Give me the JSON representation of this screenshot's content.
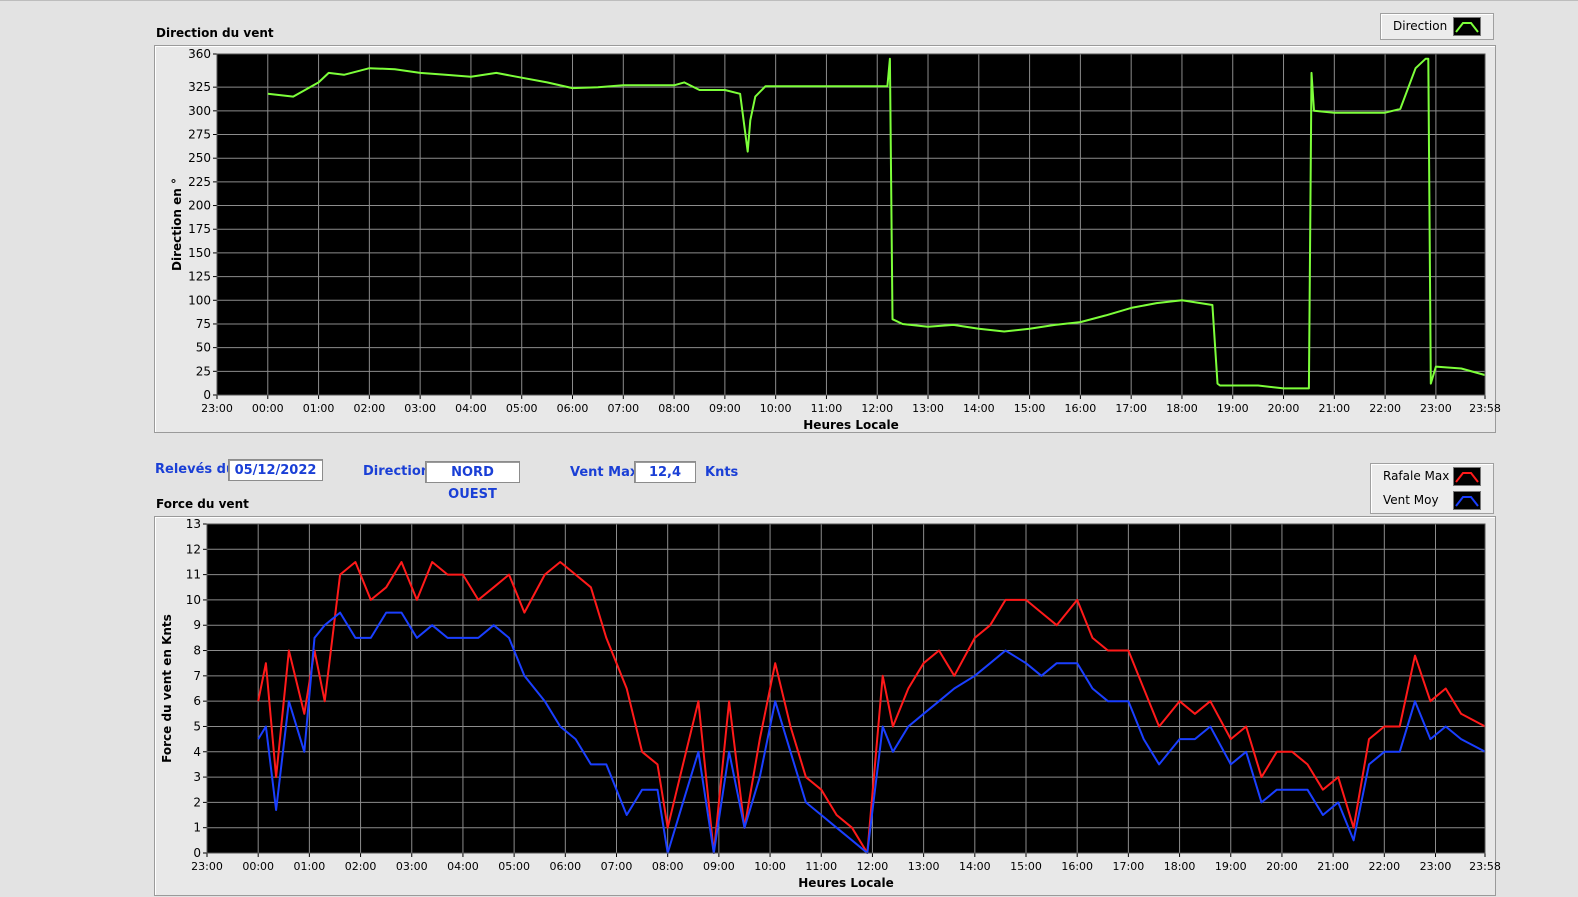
{
  "header": {
    "date_label": "Relevés du",
    "date_value": "05/12/2022",
    "direction_label": "Direction",
    "direction_value": "NORD OUEST",
    "vent_max_label": "Vent Max",
    "vent_max_value": "12,4",
    "vent_max_unit": "Knts"
  },
  "legends": {
    "direction": {
      "label": "Direction",
      "color": "#7dff3a"
    },
    "rafale": {
      "label": "Rafale Max",
      "color": "#ff1a1a"
    },
    "vent_moy": {
      "label": "Vent Moy",
      "color": "#1a3fff"
    }
  },
  "chart_data": [
    {
      "type": "line",
      "title": "Direction du vent",
      "xlabel": "Heures Locale",
      "ylabel": "Direction en °",
      "ylim": [
        0,
        360
      ],
      "yticks": [
        0,
        25,
        50,
        75,
        100,
        125,
        150,
        175,
        200,
        225,
        250,
        275,
        300,
        325,
        360
      ],
      "xticks": [
        "23:00",
        "00:00",
        "01:00",
        "02:00",
        "03:00",
        "04:00",
        "05:00",
        "06:00",
        "07:00",
        "08:00",
        "09:00",
        "10:00",
        "11:00",
        "12:00",
        "13:00",
        "14:00",
        "15:00",
        "16:00",
        "17:00",
        "18:00",
        "19:00",
        "20:00",
        "21:00",
        "22:00",
        "23:00",
        "23:58"
      ],
      "grid": true,
      "legend_position": "top-right",
      "series": [
        {
          "name": "Direction",
          "color": "#7dff3a",
          "x": [
            1.0,
            1.5,
            2.0,
            2.2,
            2.5,
            3.0,
            3.5,
            4.0,
            4.5,
            5.0,
            5.5,
            6.0,
            6.5,
            7.0,
            7.5,
            8.0,
            8.5,
            9.0,
            9.2,
            9.5,
            9.7,
            10.0,
            10.3,
            10.45,
            10.5,
            10.6,
            10.8,
            11.0,
            11.5,
            12.0,
            12.5,
            13.0,
            13.2,
            13.25,
            13.3,
            13.5,
            14.0,
            14.5,
            15.0,
            15.5,
            16.0,
            16.5,
            17.0,
            17.5,
            18.0,
            18.5,
            19.0,
            19.6,
            19.7,
            19.75,
            20.0,
            20.5,
            21.0,
            21.5,
            21.55,
            21.6,
            22.0,
            22.5,
            23.0,
            23.3,
            23.6,
            23.8,
            23.85,
            23.9,
            24.0,
            24.5,
            24.97
          ],
          "y": [
            318,
            315,
            330,
            340,
            338,
            345,
            344,
            340,
            338,
            336,
            340,
            335,
            330,
            324,
            325,
            327,
            327,
            327,
            330,
            322,
            322,
            322,
            318,
            257,
            290,
            315,
            326,
            326,
            326,
            326,
            326,
            326,
            326,
            355,
            80,
            75,
            72,
            74,
            70,
            67,
            70,
            74,
            77,
            84,
            92,
            97,
            100,
            95,
            12,
            10,
            10,
            10,
            7,
            7,
            340,
            300,
            298,
            298,
            298,
            302,
            345,
            355,
            355,
            12,
            30,
            28,
            21
          ]
        }
      ]
    },
    {
      "type": "line",
      "title": "Force du vent",
      "xlabel": "Heures Locale",
      "ylabel": "Force du vent en Knts",
      "ylim": [
        0,
        13
      ],
      "yticks": [
        0,
        1,
        2,
        3,
        4,
        5,
        6,
        7,
        8,
        9,
        10,
        11,
        12,
        13
      ],
      "xticks": [
        "23:00",
        "00:00",
        "01:00",
        "02:00",
        "03:00",
        "04:00",
        "05:00",
        "06:00",
        "07:00",
        "08:00",
        "09:00",
        "10:00",
        "11:00",
        "12:00",
        "13:00",
        "14:00",
        "15:00",
        "16:00",
        "17:00",
        "18:00",
        "19:00",
        "20:00",
        "21:00",
        "22:00",
        "23:00",
        "23:58"
      ],
      "grid": true,
      "legend_position": "top-right",
      "series": [
        {
          "name": "Rafale Max",
          "color": "#ff1a1a",
          "x": [
            1.0,
            1.15,
            1.35,
            1.6,
            1.9,
            2.1,
            2.3,
            2.6,
            2.9,
            3.2,
            3.5,
            3.8,
            4.1,
            4.4,
            4.7,
            5.0,
            5.3,
            5.6,
            5.9,
            6.2,
            6.6,
            6.9,
            7.2,
            7.5,
            7.8,
            8.2,
            8.5,
            8.8,
            9.0,
            9.3,
            9.6,
            9.9,
            10.2,
            10.5,
            10.8,
            11.1,
            11.4,
            11.7,
            12.0,
            12.3,
            12.6,
            12.9,
            13.2,
            13.4,
            13.7,
            14.0,
            14.3,
            14.6,
            15.0,
            15.3,
            15.6,
            16.0,
            16.3,
            16.6,
            17.0,
            17.3,
            17.6,
            18.0,
            18.3,
            18.6,
            19.0,
            19.3,
            19.6,
            20.0,
            20.3,
            20.6,
            20.9,
            21.2,
            21.5,
            21.8,
            22.1,
            22.4,
            22.7,
            23.0,
            23.3,
            23.6,
            23.9,
            24.2,
            24.5,
            24.97
          ],
          "y": [
            6,
            7.5,
            3,
            8,
            5.5,
            8,
            6,
            11,
            11.5,
            10,
            10.5,
            11.5,
            10,
            11.5,
            11,
            11,
            10,
            10.5,
            11,
            9.5,
            11,
            11.5,
            11,
            10.5,
            8.5,
            6.5,
            4,
            3.5,
            1,
            3.5,
            6,
            0,
            6,
            1,
            4.5,
            7.5,
            5,
            3,
            2.5,
            1.5,
            1,
            0,
            7,
            5,
            6.5,
            7.5,
            8,
            7,
            8.5,
            9,
            10,
            10,
            9.5,
            9,
            10,
            8.5,
            8,
            8,
            6.5,
            5,
            6,
            5.5,
            6,
            4.5,
            5,
            3,
            4,
            4,
            3.5,
            2.5,
            3,
            1,
            4.5,
            5,
            5,
            7.8,
            6,
            6.5,
            5.5,
            5
          ]
        },
        {
          "name": "Vent Moy",
          "color": "#1a3fff",
          "x": [
            1.0,
            1.15,
            1.35,
            1.6,
            1.9,
            2.1,
            2.3,
            2.6,
            2.9,
            3.2,
            3.5,
            3.8,
            4.1,
            4.4,
            4.7,
            5.0,
            5.3,
            5.6,
            5.9,
            6.2,
            6.6,
            6.9,
            7.2,
            7.5,
            7.8,
            8.2,
            8.5,
            8.8,
            9.0,
            9.3,
            9.6,
            9.9,
            10.2,
            10.5,
            10.8,
            11.1,
            11.4,
            11.7,
            12.0,
            12.3,
            12.6,
            12.9,
            13.2,
            13.4,
            13.7,
            14.0,
            14.3,
            14.6,
            15.0,
            15.3,
            15.6,
            16.0,
            16.3,
            16.6,
            17.0,
            17.3,
            17.6,
            18.0,
            18.3,
            18.6,
            19.0,
            19.3,
            19.6,
            20.0,
            20.3,
            20.6,
            20.9,
            21.2,
            21.5,
            21.8,
            22.1,
            22.4,
            22.7,
            23.0,
            23.3,
            23.6,
            23.9,
            24.2,
            24.5,
            24.97
          ],
          "y": [
            4.5,
            5,
            1.7,
            6,
            4,
            8.5,
            9,
            9.5,
            8.5,
            8.5,
            9.5,
            9.5,
            8.5,
            9,
            8.5,
            8.5,
            8.5,
            9,
            8.5,
            7,
            6,
            5,
            4.5,
            3.5,
            3.5,
            1.5,
            2.5,
            2.5,
            0,
            2,
            4,
            0,
            4,
            1,
            3,
            6,
            4,
            2,
            1.5,
            1,
            0.5,
            0,
            5,
            4,
            5,
            5.5,
            6,
            6.5,
            7,
            7.5,
            8,
            7.5,
            7,
            7.5,
            7.5,
            6.5,
            6,
            6,
            4.5,
            3.5,
            4.5,
            4.5,
            5,
            3.5,
            4,
            2,
            2.5,
            2.5,
            2.5,
            1.5,
            2,
            0.5,
            3.5,
            4,
            4,
            6,
            4.5,
            5,
            4.5,
            4
          ]
        }
      ]
    }
  ]
}
